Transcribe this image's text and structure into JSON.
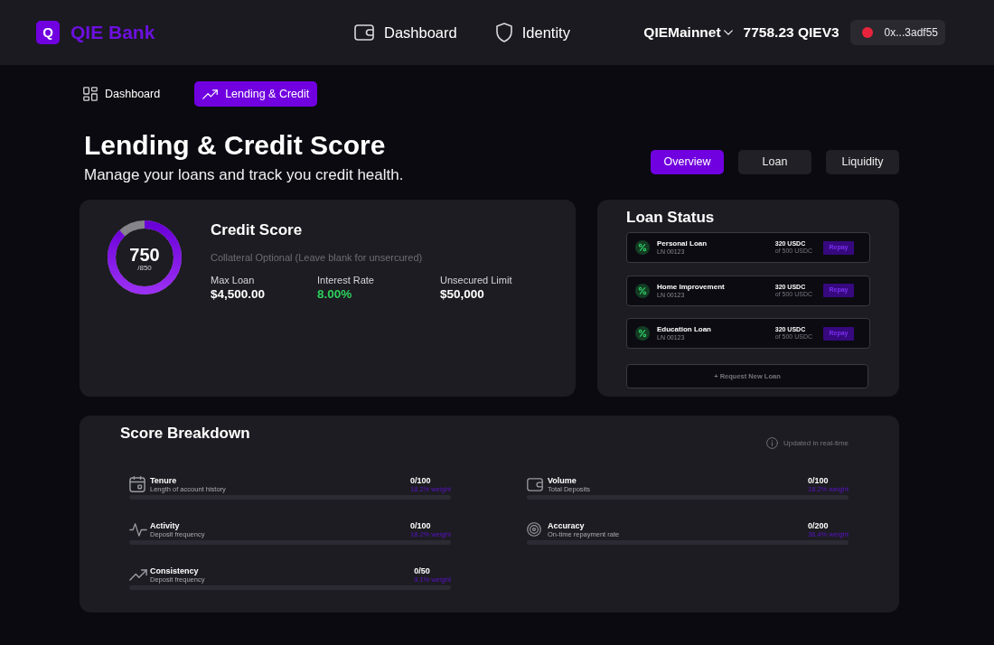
{
  "header": {
    "logo_mark": "Q",
    "brand": "QIE Bank",
    "nav": [
      {
        "label": "Dashboard"
      },
      {
        "label": "Identity"
      }
    ],
    "network": "QIEMainnet",
    "balance": "7758.23 QIEV3",
    "wallet_address": "0x...3adf55"
  },
  "breadcrumbs": [
    {
      "label": "Dashboard",
      "selected": false
    },
    {
      "label": "Lending & Credit",
      "selected": true
    }
  ],
  "page": {
    "title": "Lending & Credit Score",
    "subtitle": "Manage your loans and track you credit health."
  },
  "tabs": [
    {
      "label": "Overview",
      "selected": true
    },
    {
      "label": "Loan",
      "selected": false
    },
    {
      "label": "Liquidity",
      "selected": false
    }
  ],
  "credit_score": {
    "title": "Credit Score",
    "score": "750",
    "max": "/850",
    "level": 0.88,
    "note": "Collateral Optional (Leave blank for unsercured)",
    "stats": [
      {
        "label": "Max Loan",
        "value": "$4,500.00",
        "kind": "amount"
      },
      {
        "label": "Interest Rate",
        "value": "8.00%",
        "kind": "rate"
      },
      {
        "label": "Unsecured Limit",
        "value": "$50,000",
        "kind": "amount"
      }
    ]
  },
  "loan_status": {
    "title": "Loan Status",
    "loans": [
      {
        "name": "Personal Loan",
        "id": "LN 00123",
        "amount": "320 USDC",
        "total": "of 500 USDC",
        "action": "Repay"
      },
      {
        "name": "Home Improvement",
        "id": "LN 00123",
        "amount": "320 USDC",
        "total": "of 500 USDC",
        "action": "Repay"
      },
      {
        "name": "Education Loan",
        "id": "LN 00123",
        "amount": "320 USDC",
        "total": "of 500 USDC",
        "action": "Repay"
      }
    ],
    "request_button": "+ Request New Loan"
  },
  "score_breakdown": {
    "title": "Score Breakdown",
    "note": "Updated in real-time",
    "columns": [
      {
        "metrics": [
          {
            "name": "Tenure",
            "description": "Length of account history",
            "score": "0/100",
            "weight": "18.2% weight"
          },
          {
            "name": "Activity",
            "description": "Deposit frequency",
            "score": "0/100",
            "weight": "18.2% weight"
          },
          {
            "name": "Consistency",
            "description": "Deposit frequency",
            "score": "0/50",
            "weight": "9.1% weight"
          }
        ]
      },
      {
        "metrics": [
          {
            "name": "Volume",
            "description": "Total Deposits",
            "score": "0/100",
            "weight": "18.2% weight"
          },
          {
            "name": "Accuracy",
            "description": "On-time repayment rate",
            "score": "0/200",
            "weight": "36.4% weight"
          }
        ]
      }
    ]
  }
}
